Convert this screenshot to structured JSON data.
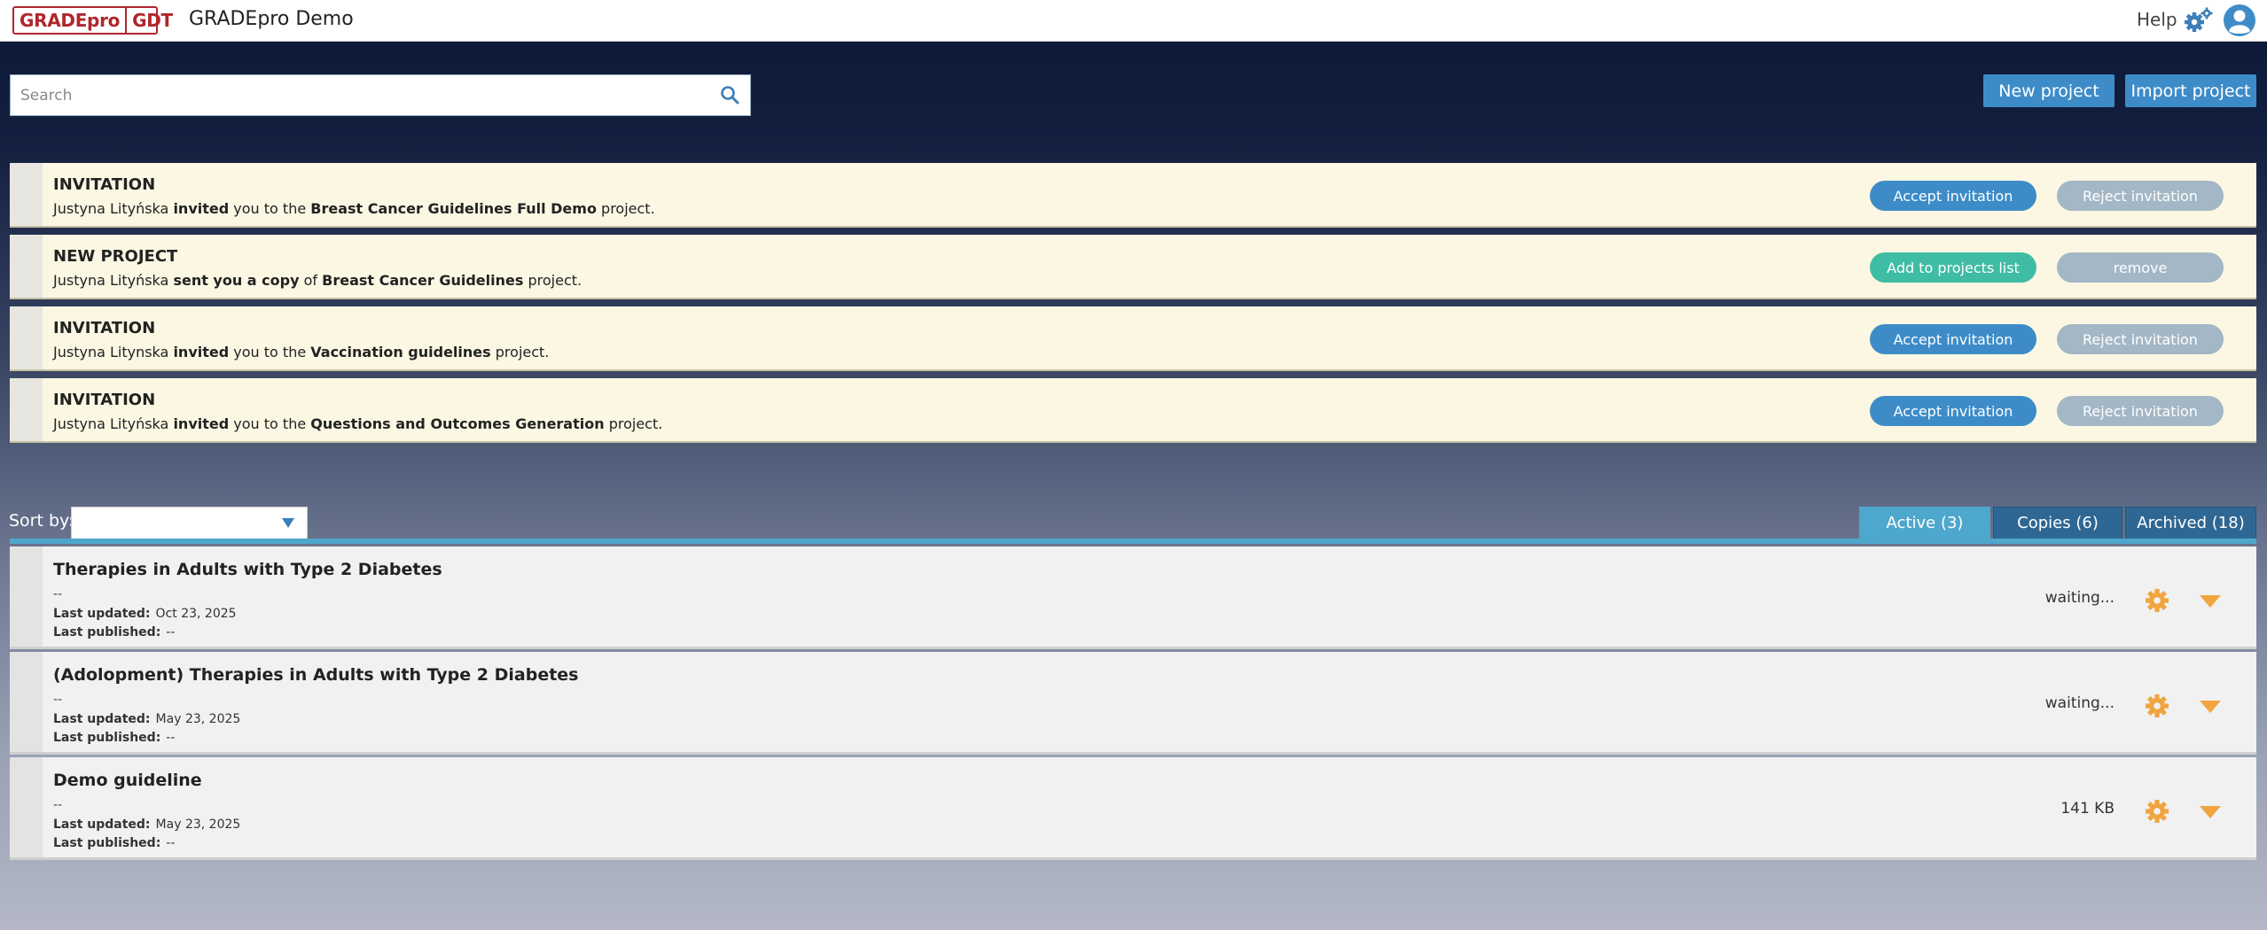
{
  "header": {
    "logo_left": "GRADEpro",
    "logo_right": "GDT",
    "app_title": "GRADEpro Demo",
    "help_label": "Help"
  },
  "search": {
    "placeholder": "Search",
    "value": ""
  },
  "actions": {
    "new_project": "New project",
    "import_project": "Import project"
  },
  "notifications": [
    {
      "title": "INVITATION",
      "sender": "Justyna Lityńska",
      "verb": "invited",
      "middle": "you to the",
      "project": "Breast Cancer Guidelines Full Demo",
      "suffix": "project.",
      "primary_label": "Accept invitation",
      "secondary_label": "Reject invitation"
    },
    {
      "title": "NEW PROJECT",
      "sender": "Justyna Lityńska",
      "verb": "sent you a copy",
      "middle": "of",
      "project": "Breast Cancer Guidelines",
      "suffix": "project.",
      "primary_label": "Add to projects list",
      "secondary_label": "remove"
    },
    {
      "title": "INVITATION",
      "sender": "Justyna Litynska",
      "verb": "invited",
      "middle": "you to the",
      "project": "Vaccination guidelines",
      "suffix": "project.",
      "primary_label": "Accept invitation",
      "secondary_label": "Reject invitation"
    },
    {
      "title": "INVITATION",
      "sender": "Justyna Lityńska",
      "verb": "invited",
      "middle": "you to the",
      "project": "Questions and Outcomes Generation",
      "suffix": "project.",
      "primary_label": "Accept invitation",
      "secondary_label": "Reject invitation"
    }
  ],
  "sort": {
    "label": "Sort by:",
    "value": ""
  },
  "tabs": [
    {
      "label": "Active (3)",
      "active": true
    },
    {
      "label": "Copies (6)",
      "active": false
    },
    {
      "label": "Archived (18)",
      "active": false
    }
  ],
  "projects": [
    {
      "name": "Therapies in Adults with Type 2 Diabetes",
      "description": "--",
      "last_updated_label": "Last updated:",
      "last_updated": "Oct 23, 2025",
      "last_published_label": "Last published:",
      "last_published": "--",
      "status": "waiting..."
    },
    {
      "name": "(Adolopment) Therapies in Adults with Type 2 Diabetes",
      "description": "--",
      "last_updated_label": "Last updated:",
      "last_updated": "May 23, 2025",
      "last_published_label": "Last published:",
      "last_published": "--",
      "status": "waiting..."
    },
    {
      "name": "Demo guideline",
      "description": "--",
      "last_updated_label": "Last updated:",
      "last_updated": "May 23, 2025",
      "last_published_label": "Last published:",
      "last_published": "--",
      "status": "141 KB"
    }
  ],
  "colors": {
    "accent": "#3d8cc8",
    "logo": "#b0262b",
    "green": "#3fbca4",
    "muted_button": "#a3b7c6",
    "tab_active": "#4ea7cc",
    "gear_orange": "#f0a540",
    "notification_bg": "#fbf7e3"
  },
  "icons": {
    "search": "search-icon",
    "settings": "gears-icon",
    "user": "user-avatar-icon",
    "project_settings": "gear-icon",
    "project_menu": "caret-down-icon"
  }
}
